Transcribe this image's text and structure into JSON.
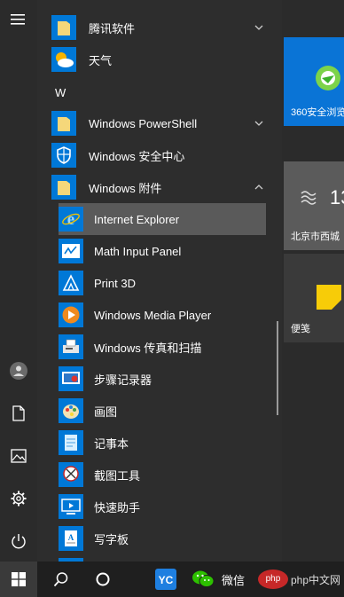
{
  "groups": [
    {
      "label": "腾讯软件"
    },
    {
      "label": "W"
    }
  ],
  "items": {
    "weather": "天气",
    "powershell": "Windows PowerShell",
    "security": "Windows 安全中心",
    "accessories": "Windows 附件",
    "ie": "Internet Explorer",
    "math": "Math Input Panel",
    "print3d": "Print 3D",
    "wmp": "Windows Media Player",
    "fax": "Windows 传真和扫描",
    "steps": "步骤记录器",
    "paint": "画图",
    "notepad": "记事本",
    "snip": "截图工具",
    "quickassist": "快速助手",
    "wordpad": "写字板"
  },
  "tiles": {
    "t360": "360安全浏览",
    "weather_city": "北京市西城",
    "weather_temp": "13",
    "notes": "便笺"
  },
  "taskbar": {
    "wechat": "微信",
    "watermark": "php中文网"
  },
  "colors": {
    "accent": "#0078d7",
    "folder": "#f5d77a",
    "tile_blue": "#0a74d6",
    "sticky": "#f7cc08"
  },
  "icons": {
    "menu": "hamburger-icon",
    "user": "user-icon",
    "docs": "document-icon",
    "pics": "pictures-icon",
    "settings": "gear-icon",
    "power": "power-icon"
  }
}
